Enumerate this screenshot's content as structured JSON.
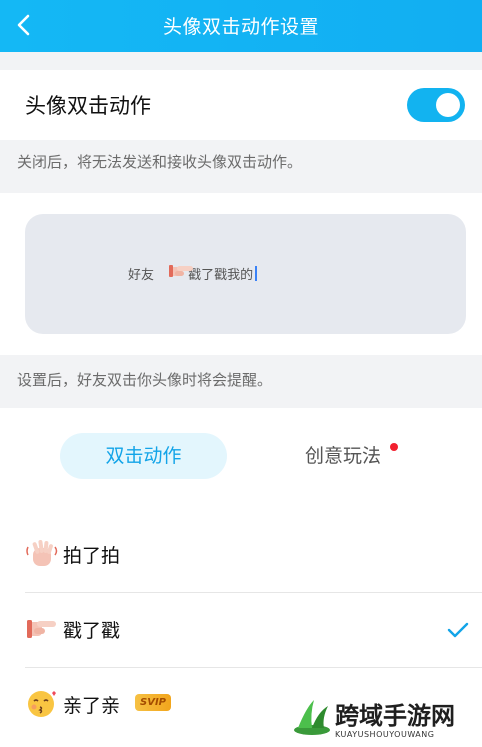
{
  "header": {
    "title": "头像双击动作设置",
    "back_icon": "chevron-left-icon"
  },
  "toggle_row": {
    "label": "头像双击动作",
    "enabled": true
  },
  "hint_disable": "关闭后，将无法发送和接收头像双击动作。",
  "preview": {
    "prefix": "好友",
    "hand_icon": "pointing-hand-icon",
    "suffix": "戳了戳我的"
  },
  "hint_set": "设置后，好友双击你头像时将会提醒。",
  "tabs": [
    {
      "label": "双击动作",
      "active": true
    },
    {
      "label": "创意玩法",
      "active": false,
      "has_dot": true
    }
  ],
  "actions": [
    {
      "label": "拍了拍",
      "icon": "waving-hand-icon",
      "selected": false
    },
    {
      "label": "戳了戳",
      "icon": "pointing-hand-icon",
      "selected": true
    },
    {
      "label": "亲了亲",
      "icon": "kissing-face-icon",
      "selected": false,
      "badge": "SVIP"
    }
  ],
  "colors": {
    "accent": "#12b3f0",
    "tab_active_bg": "#e3f6fd",
    "red_dot": "#f2202f"
  },
  "watermark": {
    "title": "跨域手游网",
    "subtitle": "KUAYUSHOUYOUWANG"
  }
}
